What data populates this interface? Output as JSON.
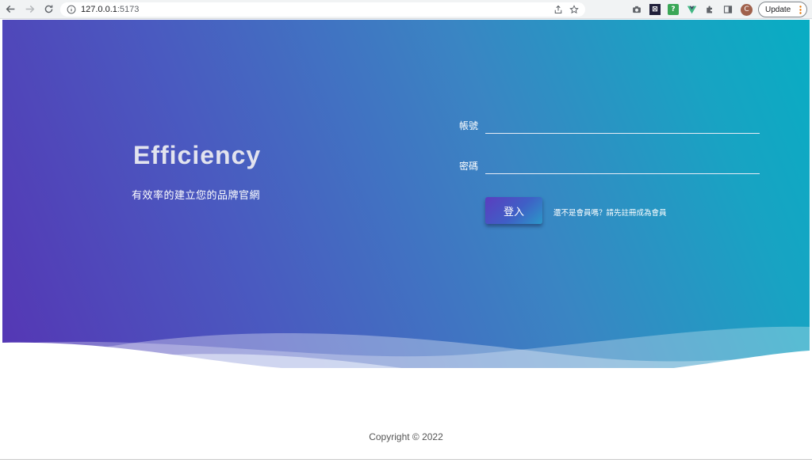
{
  "browser": {
    "url_host": "127.0.0.1",
    "url_port": ":5173",
    "update_label": "Update",
    "profile_initial": "C"
  },
  "brand": {
    "title": "Efficiency",
    "subtitle": "有效率的建立您的品牌官網"
  },
  "login_form": {
    "account_label": "帳號",
    "account_value": "",
    "password_label": "密碼",
    "password_value": "",
    "submit_label": "登入",
    "register_link": "還不是會員嗎？請先註冊成為會員"
  },
  "footer": {
    "copyright": "Copyright © 2022"
  },
  "colors": {
    "gradient_start": "#5536b4",
    "gradient_end": "#08adc3",
    "text_light": "#ffffff",
    "footer_text": "#555555"
  }
}
